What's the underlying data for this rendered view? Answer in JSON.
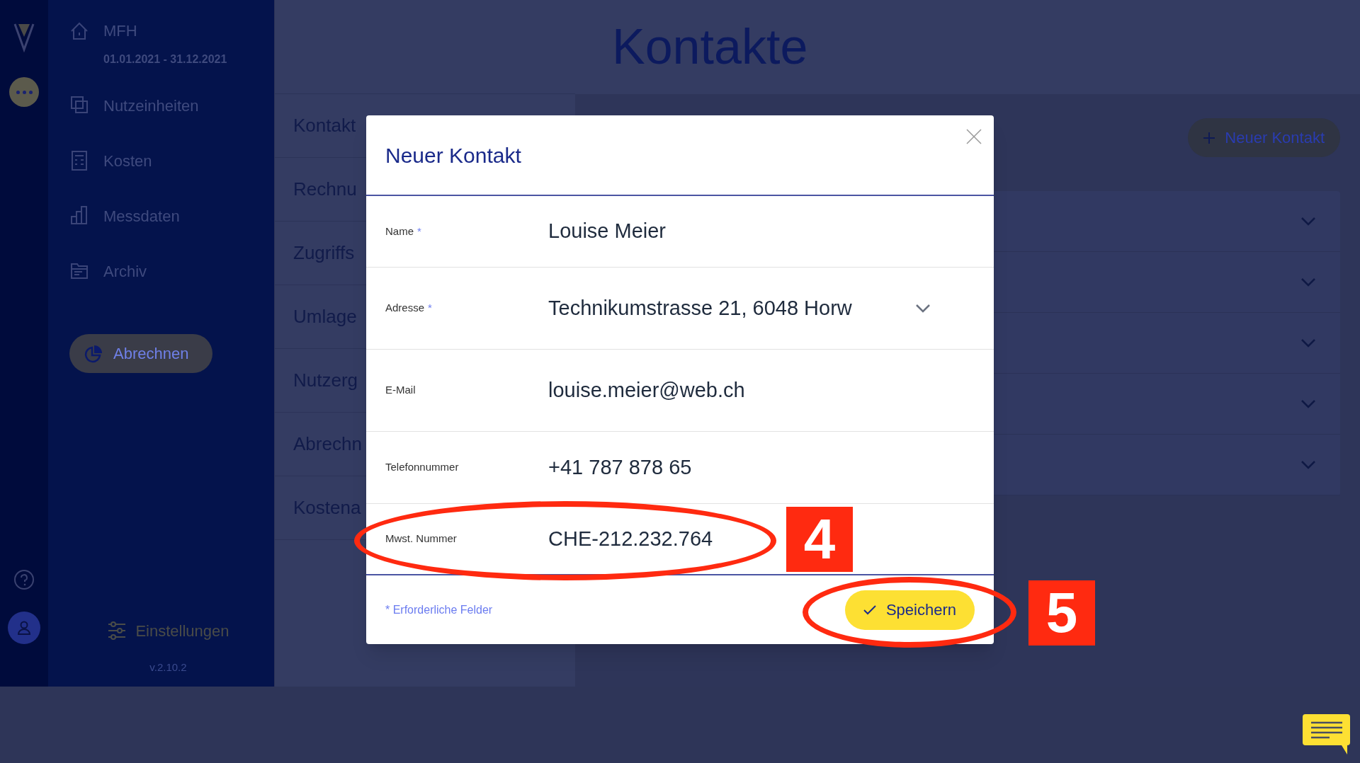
{
  "sidebar": {
    "project": "MFH",
    "period": "01.01.2021 - 31.12.2021",
    "items": [
      {
        "label": "Nutzeinheiten"
      },
      {
        "label": "Kosten"
      },
      {
        "label": "Messdaten"
      },
      {
        "label": "Archiv"
      }
    ],
    "action_button": "Abrechnen",
    "settings": "Einstellungen",
    "version": "v.2.10.2"
  },
  "submenu": [
    "Kontakt",
    "Rechnu",
    "Zugriffs",
    "Umlage",
    "Nutzerg",
    "Abrechn",
    "Kostena"
  ],
  "page": {
    "title": "Kontakte",
    "new_button": "Neuer Kontakt"
  },
  "modal": {
    "title": "Neuer Kontakt",
    "required_mark": "*",
    "fields": [
      {
        "label": "Name",
        "required": true,
        "kind": "text",
        "value": "Louise Meier"
      },
      {
        "label": "Adresse",
        "required": true,
        "kind": "select",
        "value": "Technikumstrasse 21, 6048 Horw"
      },
      {
        "label": "E-Mail",
        "required": false,
        "kind": "text",
        "value": "louise.meier@web.ch"
      },
      {
        "label": "Telefonnummer",
        "required": false,
        "kind": "text",
        "value": "+41 787 878 65"
      },
      {
        "label": "Mwst. Nummer",
        "required": false,
        "kind": "text",
        "value": "CHE-212.232.764"
      }
    ],
    "footnote": "* Erforderliche Felder",
    "save_button": "Speichern"
  },
  "annotations": [
    {
      "number": "4"
    },
    {
      "number": "5"
    }
  ]
}
